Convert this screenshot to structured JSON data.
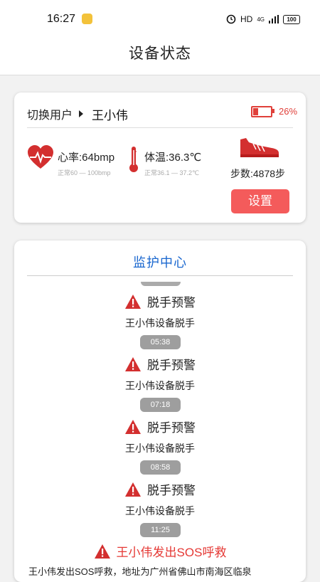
{
  "status_bar": {
    "time": "16:27",
    "network": "HD",
    "signal": "4G",
    "battery": "100"
  },
  "page": {
    "title": "设备状态"
  },
  "user_card": {
    "switch_label": "切换用户",
    "user_name": "王小伟",
    "battery_percent": "26%",
    "heart_rate": "心率:64bmp",
    "heart_rate_range": "正常60 — 100bmp",
    "temperature": "体温:36.3℃",
    "temperature_range": "正常36.1 — 37.2℃",
    "steps": "步数:4878步",
    "settings_label": "设置",
    "accent_color": "#f45b5b"
  },
  "monitor": {
    "title": "监护中心",
    "events": [
      {
        "title": "脱手预警",
        "body": "王小伟设备脱手",
        "time": "05:38"
      },
      {
        "title": "脱手预警",
        "body": "王小伟设备脱手",
        "time": "07:18"
      },
      {
        "title": "脱手预警",
        "body": "王小伟设备脱手",
        "time": "08:58"
      },
      {
        "title": "脱手预警",
        "body": "王小伟设备脱手",
        "time": "11:25"
      }
    ],
    "sos_title": "王小伟发出SOS呼救",
    "sos_body": "王小伟发出SOS呼救，地址为广州省佛山市南海区临泉",
    "title_color": "#1a67cf"
  }
}
